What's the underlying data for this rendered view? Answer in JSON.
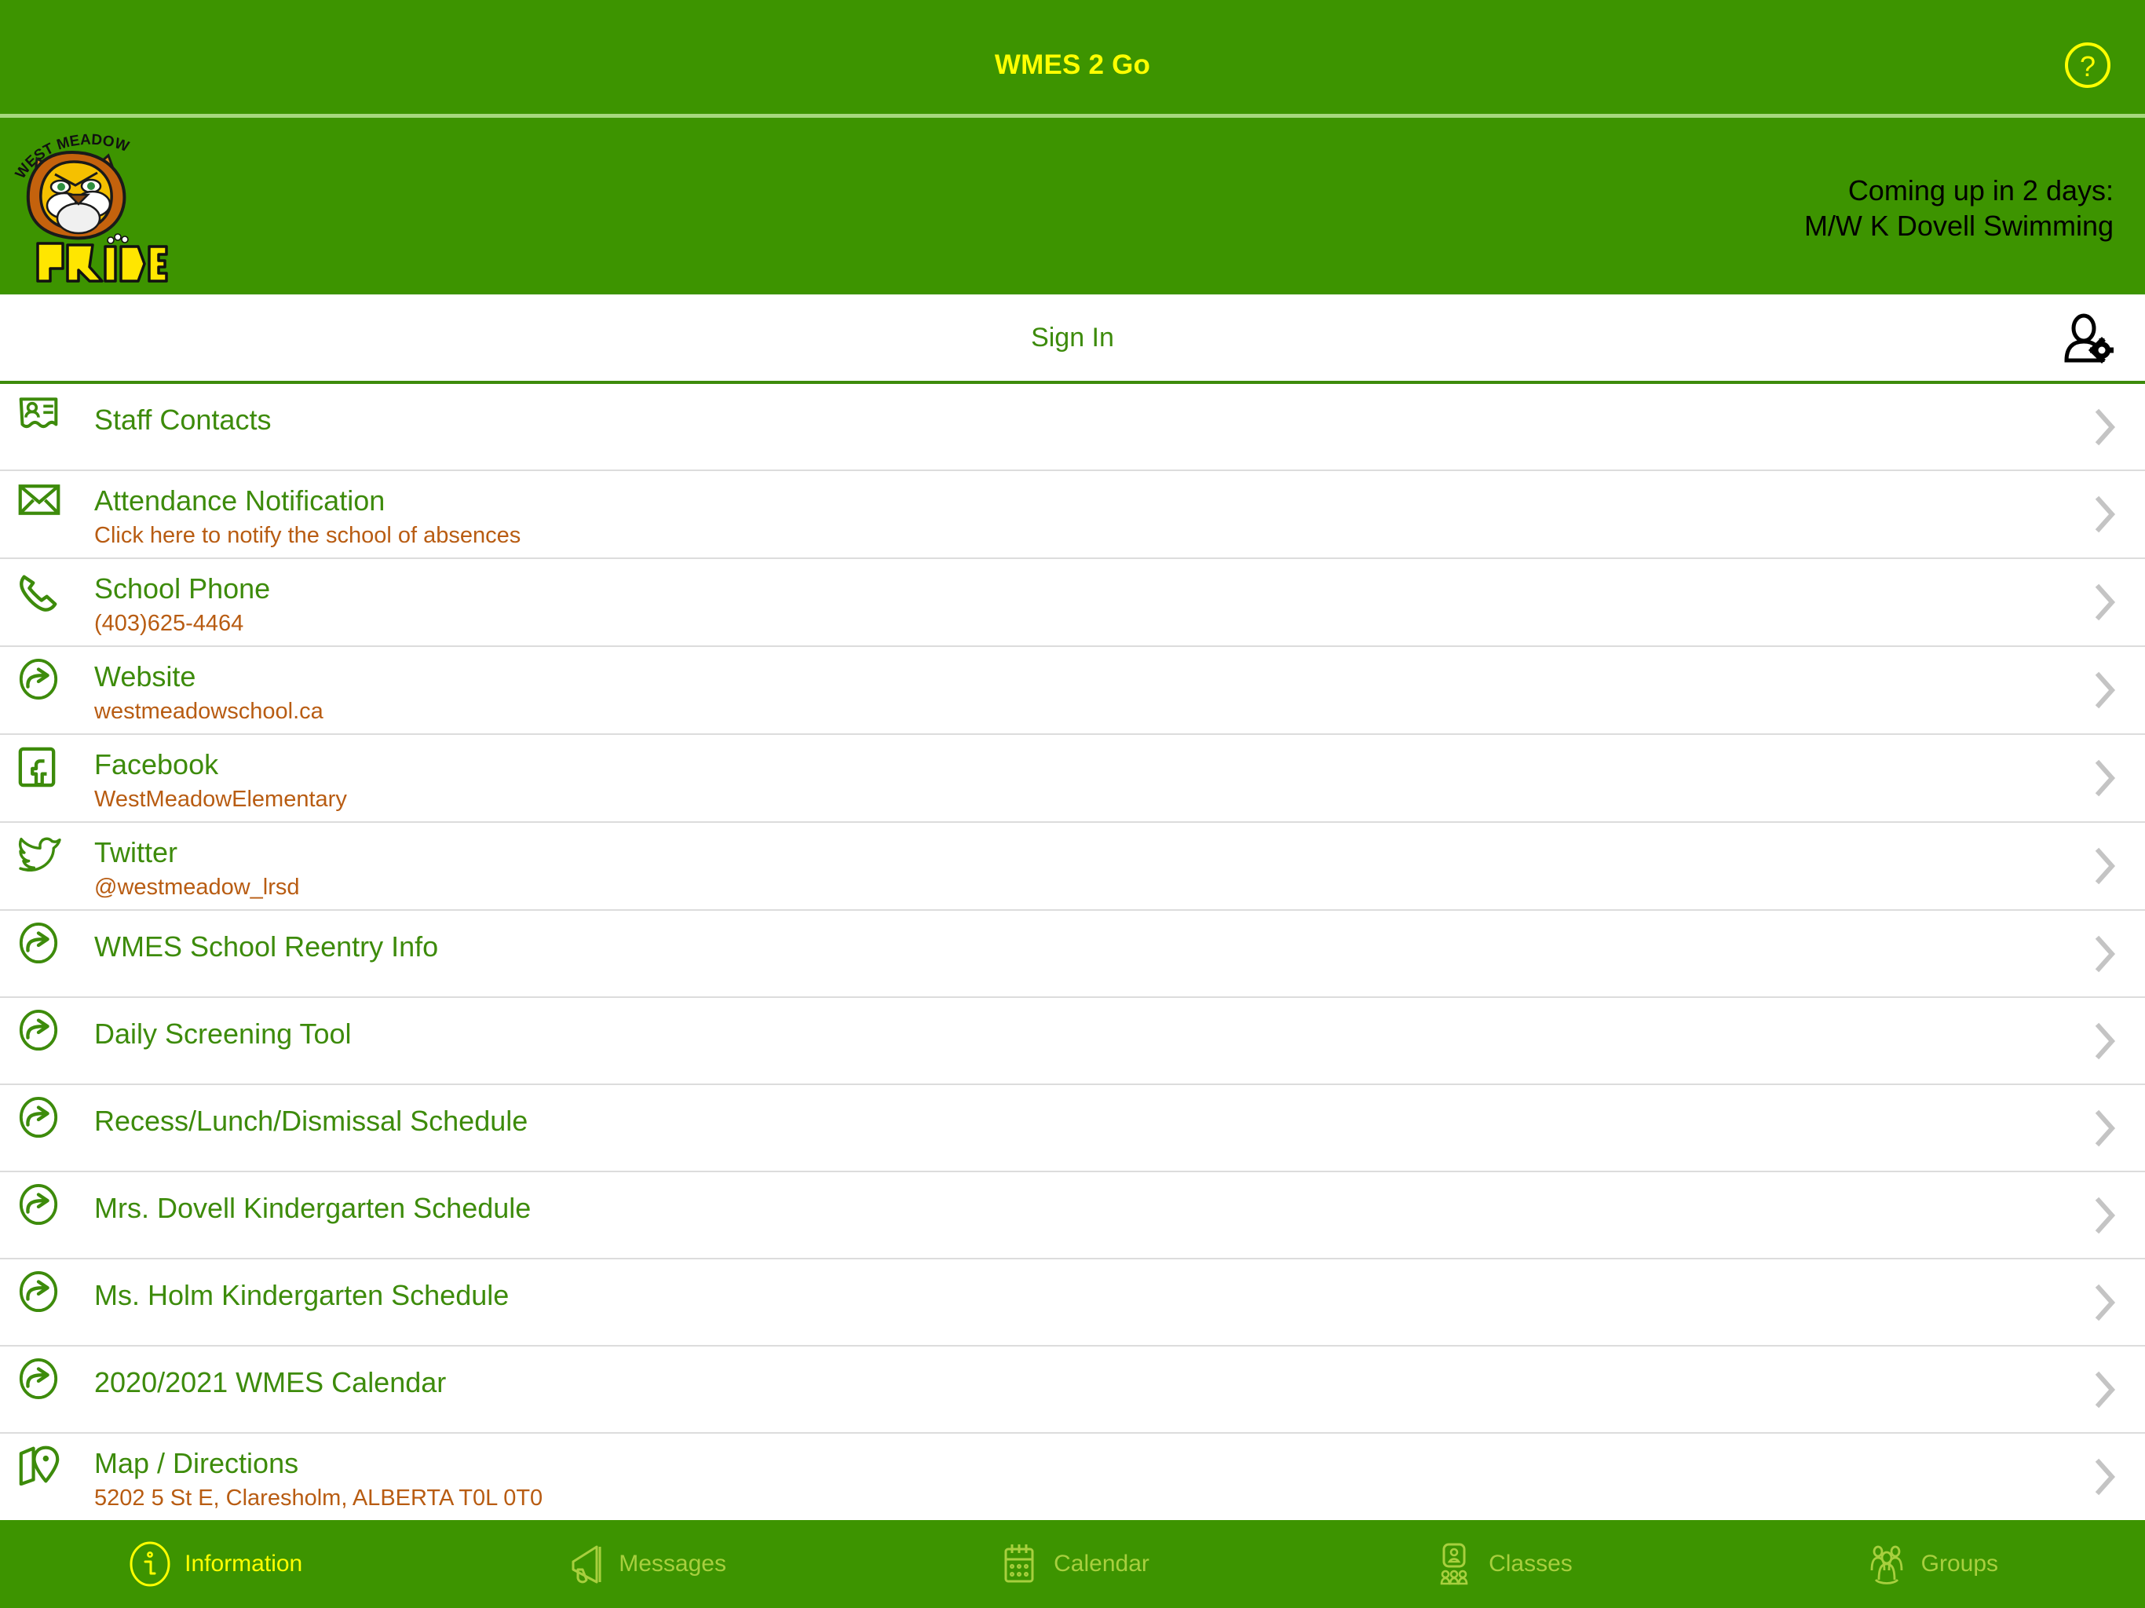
{
  "titlebar": {
    "title": "WMES 2 Go",
    "help_icon": "question-mark-circle-icon"
  },
  "banner": {
    "logo_alt": "West Meadow Pride lion mascot logo",
    "notice_line1": "Coming up in 2 days:",
    "notice_line2": "M/W K Dovell Swimming"
  },
  "signin": {
    "label": "Sign In",
    "account_icon": "user-settings-icon"
  },
  "list": {
    "items": [
      {
        "icon": "contact-card-icon",
        "title": "Staff Contacts",
        "subtitle": ""
      },
      {
        "icon": "envelope-icon",
        "title": "Attendance Notification",
        "subtitle": "Click here to notify the school of absences"
      },
      {
        "icon": "phone-icon",
        "title": "School Phone",
        "subtitle": "(403)625-4464"
      },
      {
        "icon": "external-link-icon",
        "title": "Website",
        "subtitle": "westmeadowschool.ca"
      },
      {
        "icon": "facebook-icon",
        "title": "Facebook",
        "subtitle": "WestMeadowElementary"
      },
      {
        "icon": "twitter-icon",
        "title": "Twitter",
        "subtitle": "@westmeadow_lrsd"
      },
      {
        "icon": "external-link-icon",
        "title": "WMES School Reentry Info",
        "subtitle": ""
      },
      {
        "icon": "external-link-icon",
        "title": "Daily Screening Tool",
        "subtitle": ""
      },
      {
        "icon": "external-link-icon",
        "title": "Recess/Lunch/Dismissal Schedule",
        "subtitle": ""
      },
      {
        "icon": "external-link-icon",
        "title": "Mrs. Dovell Kindergarten Schedule",
        "subtitle": ""
      },
      {
        "icon": "external-link-icon",
        "title": "Ms. Holm Kindergarten Schedule",
        "subtitle": ""
      },
      {
        "icon": "external-link-icon",
        "title": "2020/2021 WMES Calendar",
        "subtitle": ""
      },
      {
        "icon": "map-pin-icon",
        "title": "Map / Directions",
        "subtitle": "5202 5 St E, Claresholm, ALBERTA T0L 0T0"
      }
    ],
    "chevron_icon": "chevron-right-icon"
  },
  "tabbar": {
    "tabs": [
      {
        "label": "Information",
        "icon": "info-circle-icon",
        "active": true
      },
      {
        "label": "Messages",
        "icon": "megaphone-icon",
        "active": false
      },
      {
        "label": "Calendar",
        "icon": "calendar-icon",
        "active": false
      },
      {
        "label": "Classes",
        "icon": "classes-people-icon",
        "active": false
      },
      {
        "label": "Groups",
        "icon": "groups-people-icon",
        "active": false
      }
    ]
  },
  "colors": {
    "brand_green": "#3d9400",
    "link_green": "#3d8b0b",
    "accent_yellow": "#ffff00",
    "tab_inactive": "#a8cf3e",
    "subtitle_orange": "#b85c12",
    "divider_gray": "#dcdcdc"
  }
}
